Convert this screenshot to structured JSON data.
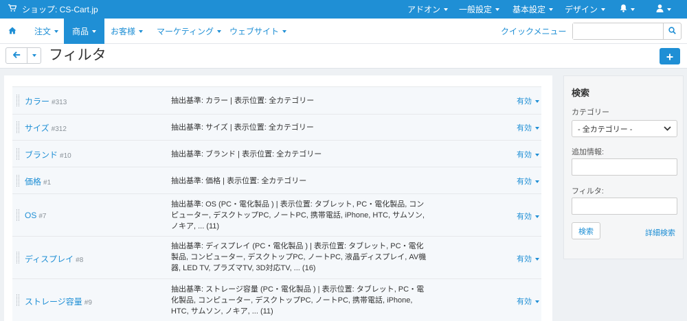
{
  "topbar": {
    "shop_label": "ショップ: CS-Cart.jp",
    "menus": [
      "アドオン",
      "一般設定",
      "基本設定",
      "デザイン"
    ]
  },
  "nav": {
    "items": [
      "注文",
      "商品",
      "お客様",
      "マーケティング",
      "ウェブサイト"
    ],
    "active": "商品",
    "quick_menu": "クイックメニュー",
    "search_value": ""
  },
  "page": {
    "title": "フィルタ"
  },
  "filters": [
    {
      "name": "カラー",
      "id": "#313",
      "desc": "抽出基準: カラー | 表示位置: 全カテゴリー",
      "status": "有効"
    },
    {
      "name": "サイズ",
      "id": "#312",
      "desc": "抽出基準: サイズ | 表示位置: 全カテゴリー",
      "status": "有効"
    },
    {
      "name": "ブランド",
      "id": "#10",
      "desc": "抽出基準: ブランド | 表示位置: 全カテゴリー",
      "status": "有効"
    },
    {
      "name": "価格",
      "id": "#1",
      "desc": "抽出基準: 価格 | 表示位置: 全カテゴリー",
      "status": "有効"
    },
    {
      "name": "OS",
      "id": "#7",
      "desc": "抽出基準: OS (PC・電化製品 ) | 表示位置: タブレット, PC・電化製品, コンピューター, デスクトップPC, ノートPC, 携帯電話, iPhone, HTC, サムソン, ノキア, ... (11)",
      "status": "有効"
    },
    {
      "name": "ディスプレイ",
      "id": "#8",
      "desc": "抽出基準: ディスプレイ (PC・電化製品 ) | 表示位置: タブレット, PC・電化製品, コンピューター, デスクトップPC, ノートPC, 液晶ディスプレイ, AV機器, LED TV, プラズマTV, 3D対応TV, ... (16)",
      "status": "有効"
    },
    {
      "name": "ストレージ容量",
      "id": "#9",
      "desc": "抽出基準: ストレージ容量 (PC・電化製品 ) | 表示位置: タブレット, PC・電化製品, コンピューター, デスクトップPC, ノートPC, 携帯電話, iPhone, HTC, サムソン, ノキア, ... (11)",
      "status": "有効"
    }
  ],
  "sidebar": {
    "title": "検索",
    "category_label": "カテゴリー",
    "category_value": "- 全カテゴリー -",
    "extra_label": "追加情報:",
    "extra_value": "",
    "filter_label": "フィルタ:",
    "filter_value": "",
    "search_button": "検索",
    "advanced_link": "詳細検索"
  },
  "colors": {
    "accent": "#1f8fd5",
    "background": "#eef1f4"
  }
}
